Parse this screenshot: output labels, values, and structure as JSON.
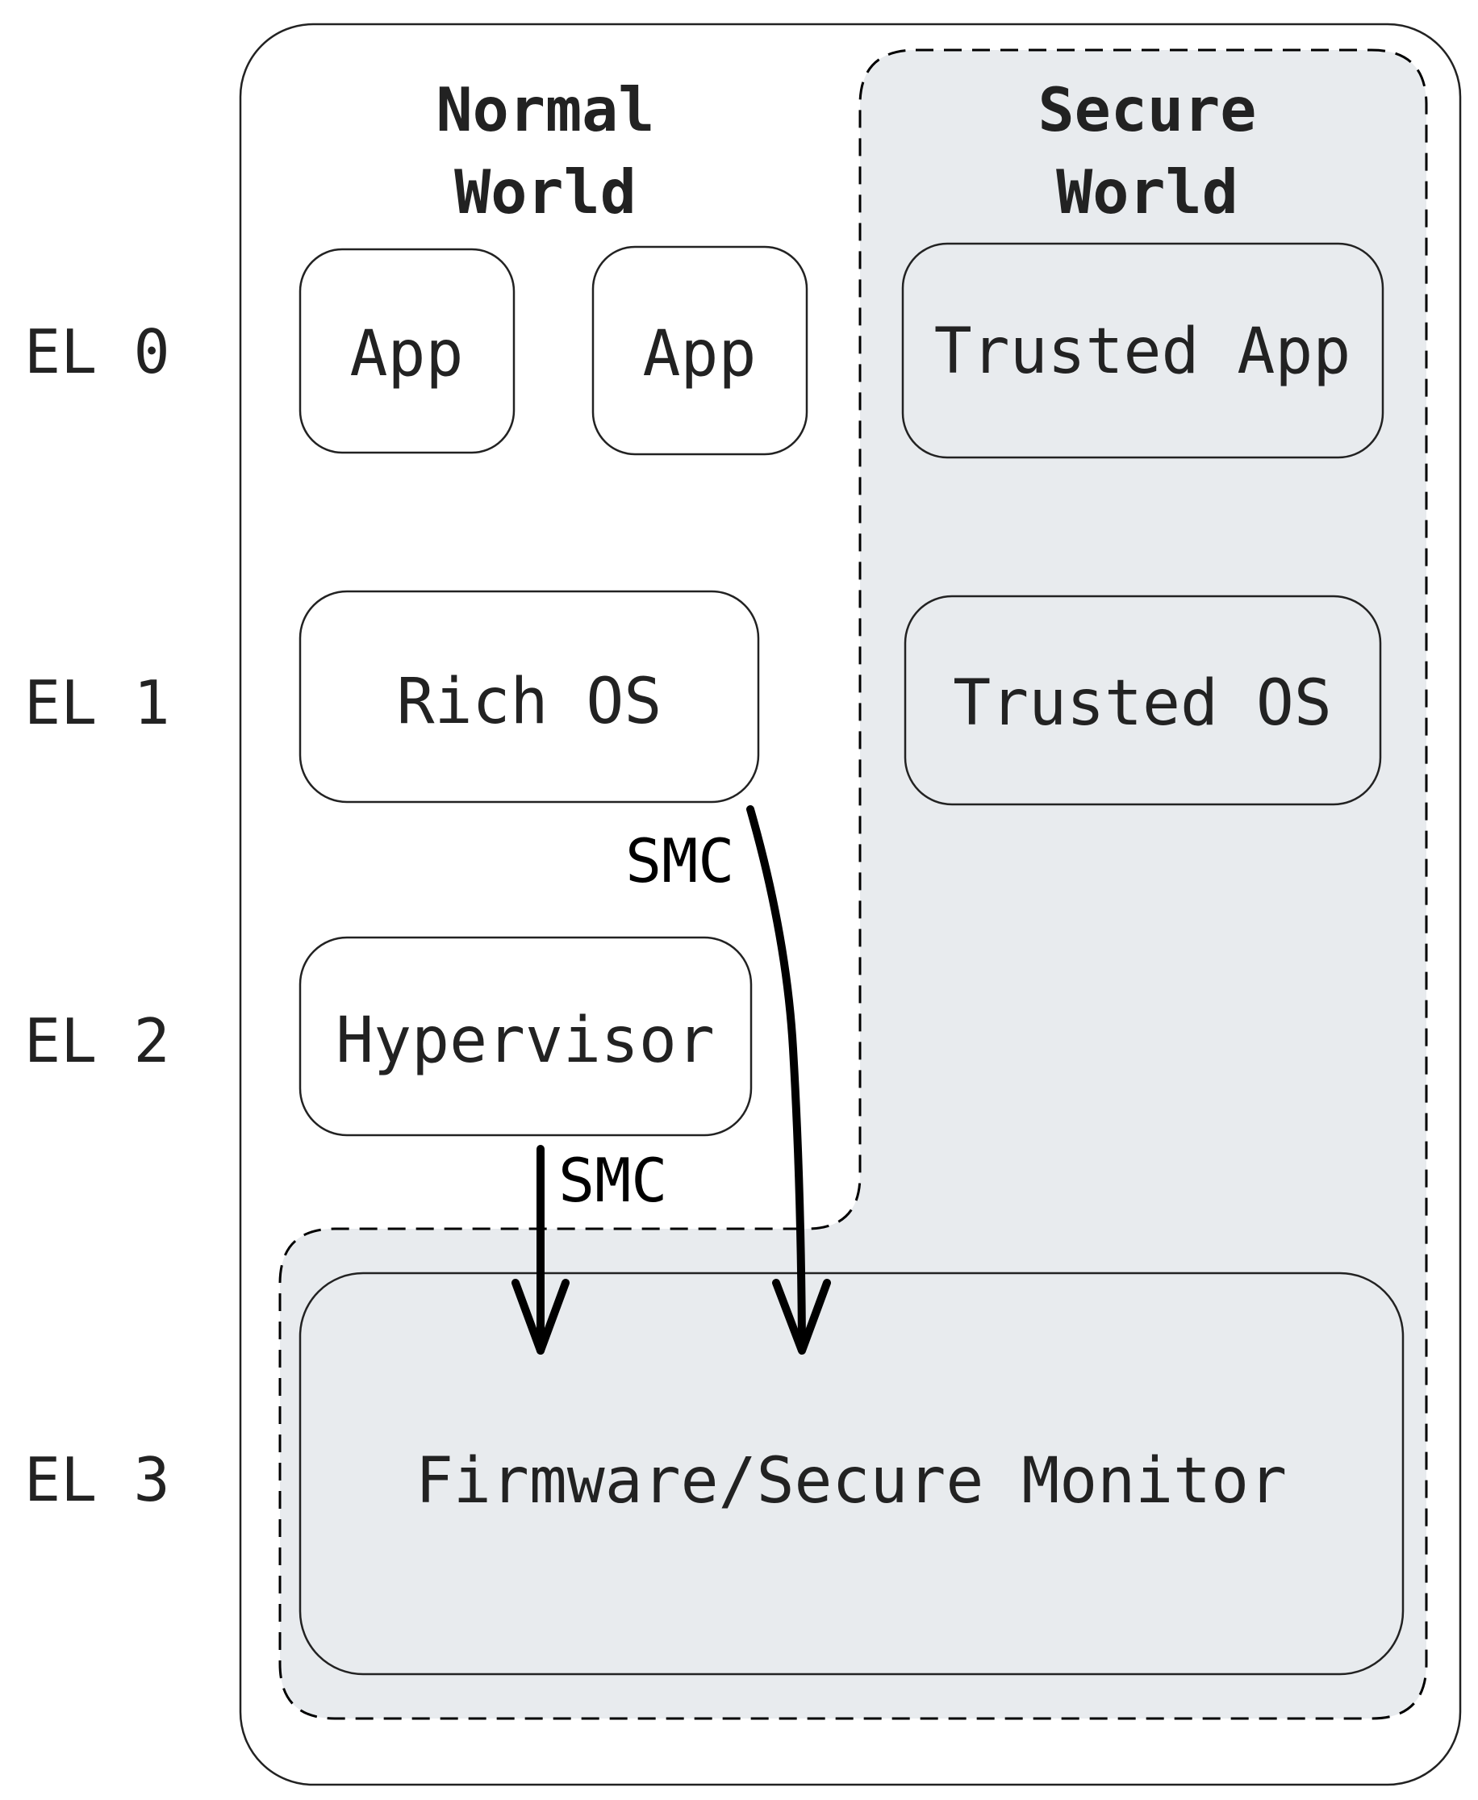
{
  "colors": {
    "secure_fill": "#e8ebee",
    "normal_fill": "#ffffff",
    "line": "#222222",
    "arrow": "#000000"
  },
  "levels": [
    "EL 0",
    "EL 1",
    "EL 2",
    "EL 3"
  ],
  "worlds": {
    "normal": {
      "title_line1": "Normal",
      "title_line2": "World"
    },
    "secure": {
      "title_line1": "Secure",
      "title_line2": "World"
    }
  },
  "boxes": {
    "app1": "App",
    "app2": "App",
    "trusted_app": "Trusted App",
    "rich_os": "Rich OS",
    "trusted_os": "Trusted OS",
    "hypervisor": "Hypervisor",
    "firmware": "Firmware/Secure Monitor"
  },
  "arrows": {
    "smc_from_rich_os": "SMC",
    "smc_from_hypervisor": "SMC"
  }
}
